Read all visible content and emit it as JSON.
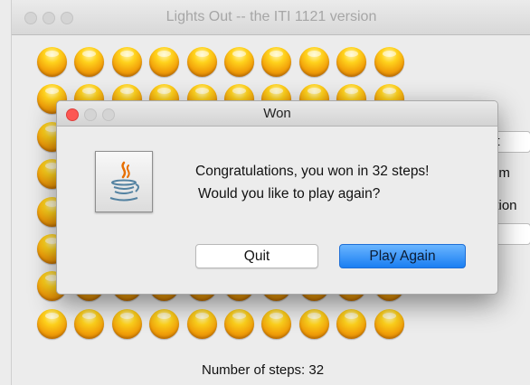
{
  "main_window": {
    "title": "Lights Out -- the ITI 1121 version",
    "side_controls": [
      {
        "label": "et",
        "type": "button"
      },
      {
        "label": "om",
        "type": "label"
      },
      {
        "label": "ution",
        "type": "label"
      },
      {
        "label": "t",
        "type": "button"
      }
    ],
    "steps": {
      "label": "Number of steps: ",
      "value": "32"
    }
  },
  "board": {
    "rows": 8,
    "cols": 10,
    "light_state": "on"
  },
  "dialog": {
    "title": "Won",
    "icon": "java-coffee-cup-icon",
    "message_line1": "Congratulations, you won in 32 steps!",
    "message_line2": "Would you like to play again?",
    "quit_label": "Quit",
    "play_again_label": "Play Again"
  },
  "colors": {
    "close_button": "#fc5753",
    "minimize_button": "#d4d4d4",
    "zoom_button": "#d4d4d4",
    "default_button": "#1a7ef2",
    "light_on": "#f5a90c"
  }
}
